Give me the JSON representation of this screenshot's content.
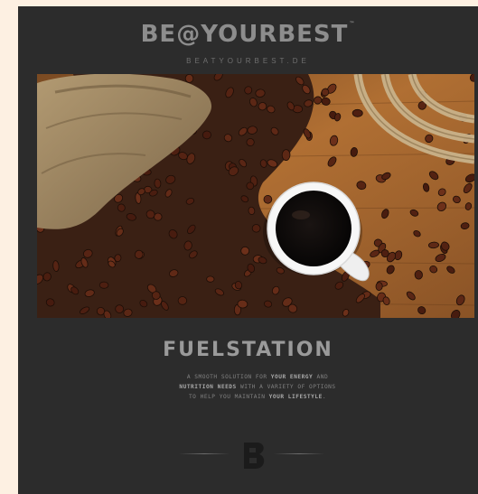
{
  "brand": {
    "logo_text": "BE@YOURBEST",
    "trademark": "™",
    "url": "BEATYOURBEST.DE",
    "mark_letter": "B"
  },
  "hero": {
    "subject": "coffee beans in burlap sack with cup of black coffee and rope on wooden table"
  },
  "content": {
    "title": "FUELSTATION",
    "tagline_line1_a": "A SMOOTH SOLUTION FOR ",
    "tagline_line1_b": "YOUR ENERGY",
    "tagline_line1_c": " AND",
    "tagline_line2_a": "NUTRITION NEEDS",
    "tagline_line2_b": " WITH A VARIETY OF OPTIONS",
    "tagline_line3_a": "TO HELP YOU MAINTAIN ",
    "tagline_line3_b": "YOUR LIFESTYLE",
    "tagline_line3_c": "."
  },
  "colors": {
    "background": "#fdf0e2",
    "page": "#2c2c2c",
    "logo": "#8d8d8d",
    "title": "#9a9a9a",
    "wood": "#a4632a"
  }
}
